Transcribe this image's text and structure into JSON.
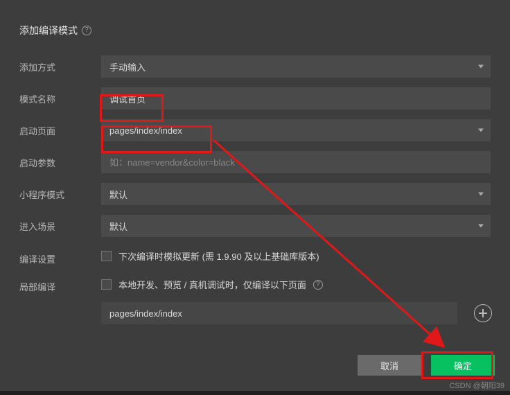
{
  "title": "添加编译模式",
  "labels": {
    "addMethod": "添加方式",
    "modeName": "模式名称",
    "startPage": "启动页面",
    "startParams": "启动参数",
    "miniProgramMode": "小程序模式",
    "enterScene": "进入场景",
    "compileSettings": "编译设置",
    "partialCompile": "局部编译"
  },
  "fields": {
    "addMethod": {
      "value": "手动输入"
    },
    "modeName": {
      "value": "调试首页"
    },
    "startPage": {
      "value": "pages/index/index"
    },
    "startParams": {
      "value": "",
      "placeholder": "如：name=vendor&color=black"
    },
    "miniProgramMode": {
      "value": "默认"
    },
    "enterScene": {
      "value": "默认"
    },
    "compileSettings": {
      "checkbox_label": "下次编译时模拟更新 (需 1.9.90 及以上基础库版本)"
    },
    "partialCompile": {
      "checkbox_label": "本地开发、预览 / 真机调试时，仅编译以下页面",
      "item0": "pages/index/index"
    }
  },
  "buttons": {
    "cancel": "取消",
    "ok": "确定"
  },
  "watermark": "CSDN @朝阳39"
}
